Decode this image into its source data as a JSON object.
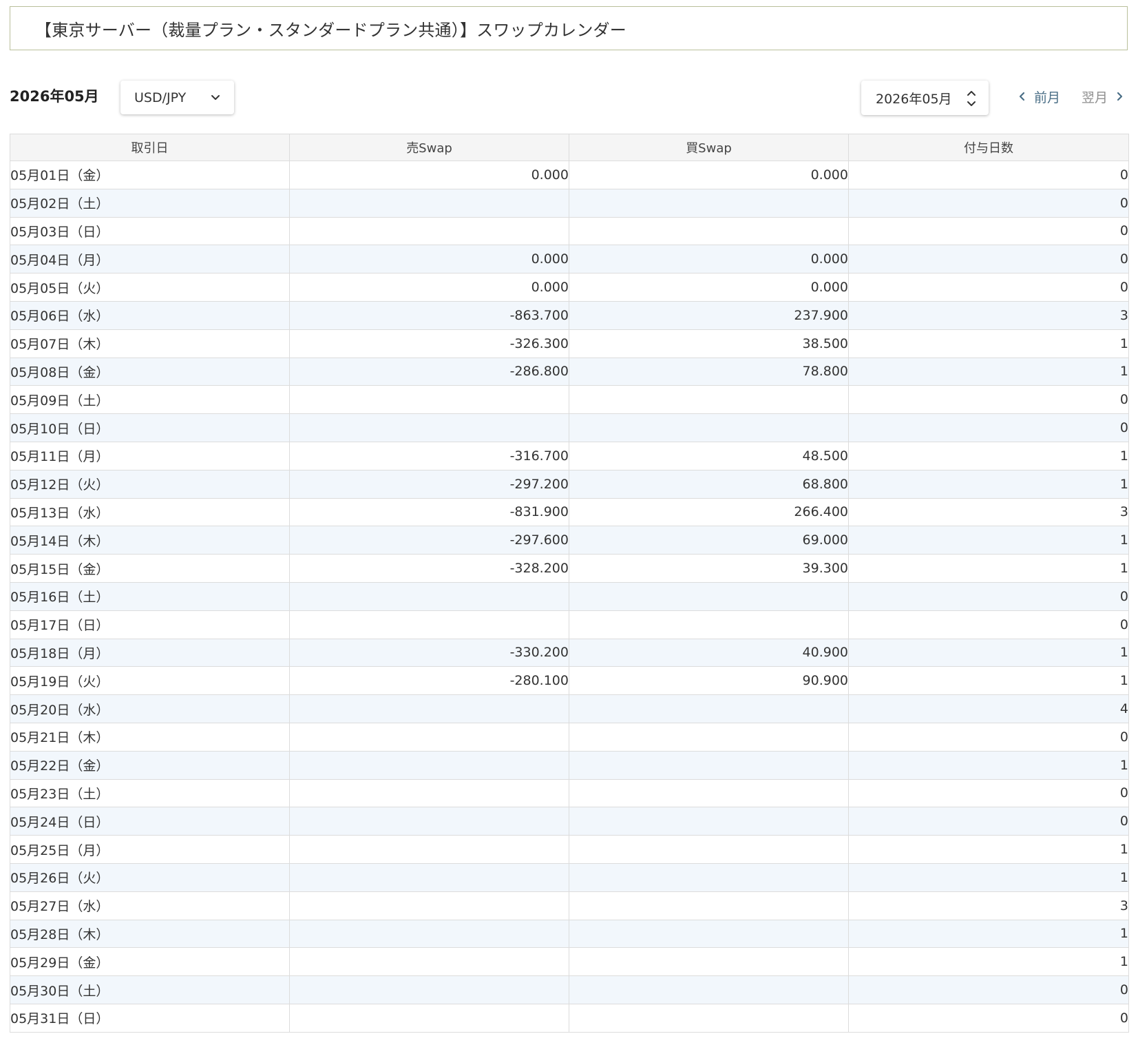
{
  "page": {
    "title": "【東京サーバー（裁量プラン・スタンダードプラン共通）】スワップカレンダー"
  },
  "toolbar": {
    "current_month": "2026年05月",
    "pair_select": {
      "value": "USD/JPY",
      "icon": "chevron-down-icon"
    },
    "month_select": {
      "value": "2026年05月",
      "icon": "updown-icon"
    },
    "prev_label": "前月",
    "next_label": "翌月",
    "colors": {
      "prev": "#4a6e86",
      "next": "#8e8e8e",
      "stripe": "#f2f7fc",
      "header_bg": "#f5f5f5",
      "title_border": "#b9bf9a"
    }
  },
  "table": {
    "headers": [
      "取引日",
      "売Swap",
      "買Swap",
      "付与日数"
    ],
    "rows": [
      {
        "date": "05月01日（金）",
        "sell": "0.000",
        "buy": "0.000",
        "days": "0"
      },
      {
        "date": "05月02日（土）",
        "sell": "",
        "buy": "",
        "days": "0"
      },
      {
        "date": "05月03日（日）",
        "sell": "",
        "buy": "",
        "days": "0"
      },
      {
        "date": "05月04日（月）",
        "sell": "0.000",
        "buy": "0.000",
        "days": "0"
      },
      {
        "date": "05月05日（火）",
        "sell": "0.000",
        "buy": "0.000",
        "days": "0"
      },
      {
        "date": "05月06日（水）",
        "sell": "-863.700",
        "buy": "237.900",
        "days": "3"
      },
      {
        "date": "05月07日（木）",
        "sell": "-326.300",
        "buy": "38.500",
        "days": "1"
      },
      {
        "date": "05月08日（金）",
        "sell": "-286.800",
        "buy": "78.800",
        "days": "1"
      },
      {
        "date": "05月09日（土）",
        "sell": "",
        "buy": "",
        "days": "0"
      },
      {
        "date": "05月10日（日）",
        "sell": "",
        "buy": "",
        "days": "0"
      },
      {
        "date": "05月11日（月）",
        "sell": "-316.700",
        "buy": "48.500",
        "days": "1"
      },
      {
        "date": "05月12日（火）",
        "sell": "-297.200",
        "buy": "68.800",
        "days": "1"
      },
      {
        "date": "05月13日（水）",
        "sell": "-831.900",
        "buy": "266.400",
        "days": "3"
      },
      {
        "date": "05月14日（木）",
        "sell": "-297.600",
        "buy": "69.000",
        "days": "1"
      },
      {
        "date": "05月15日（金）",
        "sell": "-328.200",
        "buy": "39.300",
        "days": "1"
      },
      {
        "date": "05月16日（土）",
        "sell": "",
        "buy": "",
        "days": "0"
      },
      {
        "date": "05月17日（日）",
        "sell": "",
        "buy": "",
        "days": "0"
      },
      {
        "date": "05月18日（月）",
        "sell": "-330.200",
        "buy": "40.900",
        "days": "1"
      },
      {
        "date": "05月19日（火）",
        "sell": "-280.100",
        "buy": "90.900",
        "days": "1"
      },
      {
        "date": "05月20日（水）",
        "sell": "",
        "buy": "",
        "days": "4"
      },
      {
        "date": "05月21日（木）",
        "sell": "",
        "buy": "",
        "days": "0"
      },
      {
        "date": "05月22日（金）",
        "sell": "",
        "buy": "",
        "days": "1"
      },
      {
        "date": "05月23日（土）",
        "sell": "",
        "buy": "",
        "days": "0"
      },
      {
        "date": "05月24日（日）",
        "sell": "",
        "buy": "",
        "days": "0"
      },
      {
        "date": "05月25日（月）",
        "sell": "",
        "buy": "",
        "days": "1"
      },
      {
        "date": "05月26日（火）",
        "sell": "",
        "buy": "",
        "days": "1"
      },
      {
        "date": "05月27日（水）",
        "sell": "",
        "buy": "",
        "days": "3"
      },
      {
        "date": "05月28日（木）",
        "sell": "",
        "buy": "",
        "days": "1"
      },
      {
        "date": "05月29日（金）",
        "sell": "",
        "buy": "",
        "days": "1"
      },
      {
        "date": "05月30日（土）",
        "sell": "",
        "buy": "",
        "days": "0"
      },
      {
        "date": "05月31日（日）",
        "sell": "",
        "buy": "",
        "days": "0"
      }
    ]
  }
}
